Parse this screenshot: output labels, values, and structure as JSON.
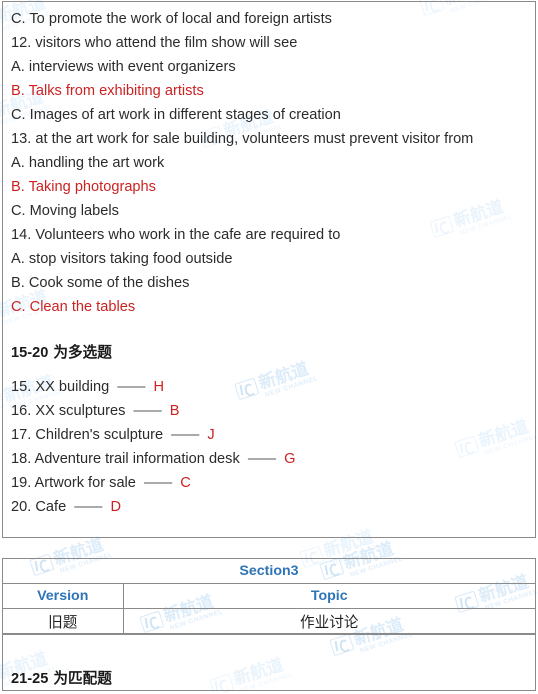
{
  "document": {
    "watermark_text": "新航道",
    "watermark_subtext": "NEW CHANNEL",
    "watermark_color": "#e0eefa",
    "red_color": "#cc2222",
    "blue_color": "#2e75b6"
  },
  "questions_panel": {
    "lines": [
      {
        "text": "C. To promote the work of local and foreign artists",
        "color": "black",
        "justify": false
      },
      {
        "text": "12. visitors who attend the film show will see",
        "color": "black",
        "justify": false
      },
      {
        "text": "A. interviews with event organizers",
        "color": "black",
        "justify": false
      },
      {
        "text": "B. Talks from exhibiting artists",
        "color": "red",
        "justify": false
      },
      {
        "text": "C. Images of art work in different stages of creation",
        "color": "black",
        "justify": false
      },
      {
        "text": "13. at the art work for sale building, volunteers must prevent visitor from",
        "color": "black",
        "justify": true
      },
      {
        "text": "A. handling the art work",
        "color": "black",
        "justify": false
      },
      {
        "text": "B. Taking photographs",
        "color": "red",
        "justify": false
      },
      {
        "text": "C. Moving labels",
        "color": "black",
        "justify": false
      },
      {
        "text": "14. Volunteers who work in the cafe are required to",
        "color": "black",
        "justify": false
      },
      {
        "text": "A. stop visitors taking food outside",
        "color": "black",
        "justify": false
      },
      {
        "text": "B. Cook some of the dishes",
        "color": "black",
        "justify": false
      },
      {
        "text": "C. Clean the tables",
        "color": "red",
        "justify": false
      }
    ],
    "subheading": {
      "range": "15-20",
      "suffix": " 为多选题"
    },
    "matching_items": [
      {
        "number": "15.",
        "label": "XX building",
        "dash": "——",
        "answer": "H"
      },
      {
        "number": "16.",
        "label": "XX sculptures",
        "dash": "——",
        "answer": "B"
      },
      {
        "number": "17.",
        "label": "Children's sculpture",
        "dash": "——",
        "answer": "J"
      },
      {
        "number": "18.",
        "label": "Adventure trail information desk",
        "dash": "——",
        "answer": "G"
      },
      {
        "number": "19.",
        "label": "Artwork for sale",
        "dash": "——",
        "answer": "C"
      },
      {
        "number": "20.",
        "label": "Cafe",
        "dash": "——",
        "answer": "D"
      }
    ]
  },
  "section3_panel": {
    "title": "Section3",
    "columns": {
      "version": "Version",
      "topic": "Topic"
    },
    "row": {
      "version": "旧题",
      "topic": "作业讨论"
    },
    "footer": {
      "range": "21-25",
      "suffix": " 为匹配题"
    }
  }
}
